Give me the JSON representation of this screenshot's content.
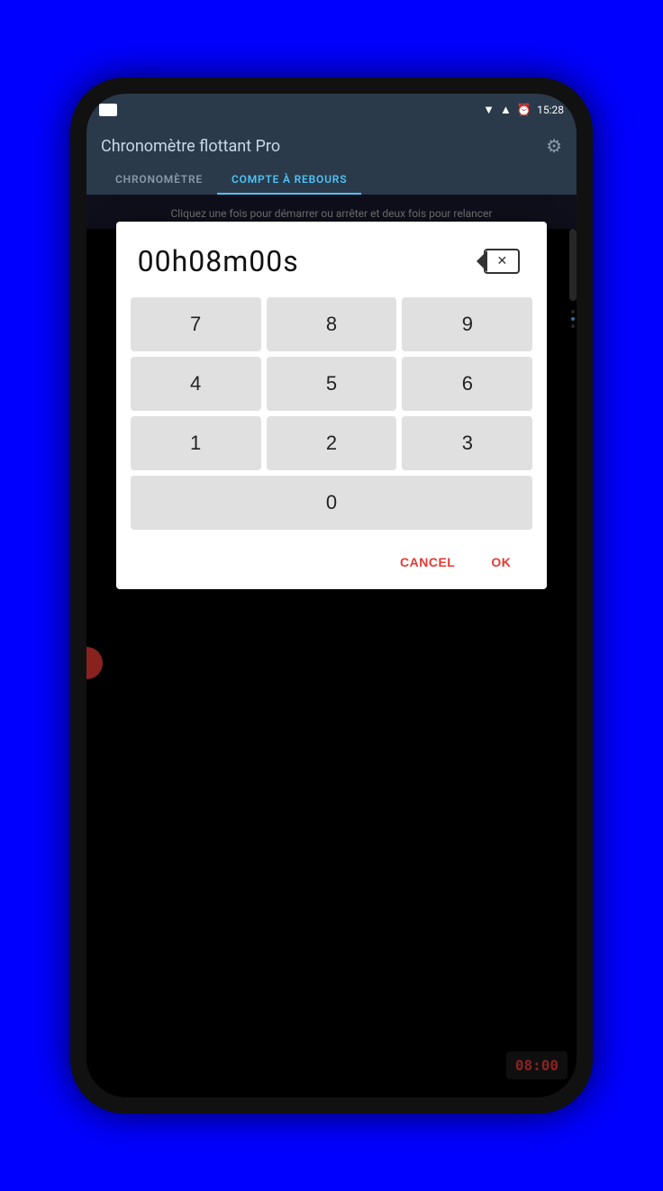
{
  "status_bar": {
    "time": "15:28"
  },
  "app_header": {
    "title": "Chronomètre flottant Pro",
    "tabs": [
      {
        "id": "chrono",
        "label": "CHRONOMÈTRE",
        "active": false
      },
      {
        "id": "countdown",
        "label": "COMPTE À REBOURS",
        "active": true
      }
    ]
  },
  "hint": {
    "text": "Cliquez une fois pour démarrer ou arrêter et deux fois pour relancer"
  },
  "dialog": {
    "time_display": "00h08m00s",
    "numpad": [
      [
        "7",
        "8",
        "9"
      ],
      [
        "4",
        "5",
        "6"
      ],
      [
        "1",
        "2",
        "3"
      ],
      [
        "0"
      ]
    ],
    "cancel_label": "CANCEL",
    "ok_label": "OK"
  },
  "floating_widget": {
    "time": "08:00"
  },
  "icons": {
    "gear": "⚙",
    "backspace_x": "✕"
  }
}
